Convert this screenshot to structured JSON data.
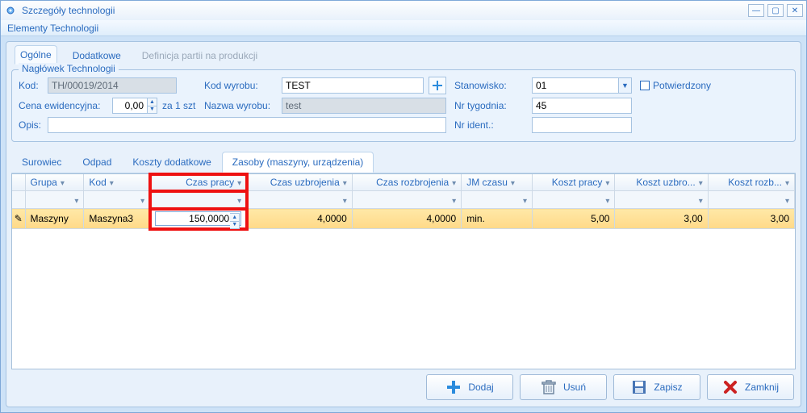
{
  "window": {
    "title": "Szczegóły technologii",
    "menubar": "Elementy Technologii"
  },
  "tabsTop": {
    "t0": "Ogólne",
    "t1": "Dodatkowe",
    "t2": "Definicja partii na produkcji"
  },
  "group": {
    "legend": "Nagłówek Technologii",
    "kod_l": "Kod:",
    "kod_v": "TH/00019/2014",
    "kodwyr_l": "Kod wyrobu:",
    "kodwyr_v": "TEST",
    "stan_l": "Stanowisko:",
    "stan_v": "01",
    "potw": "Potwierdzony",
    "cena_l": "Cena ewidencyjna:",
    "cena_v": "0,00",
    "cena_unit": "za 1 szt",
    "nazwa_l": "Nazwa wyrobu:",
    "nazwa_v": "test",
    "tydz_l": "Nr tygodnia:",
    "tydz_v": "45",
    "opis_l": "Opis:",
    "opis_v": "",
    "ident_l": "Nr ident.:",
    "ident_v": ""
  },
  "subtabs": {
    "s0": "Surowiec",
    "s1": "Odpad",
    "s2": "Koszty dodatkowe",
    "s3": "Zasoby (maszyny, urządzenia)"
  },
  "cols": {
    "c0": "Grupa",
    "c1": "Kod",
    "c2": "Czas pracy",
    "c3": "Czas uzbrojenia",
    "c4": "Czas rozbrojenia",
    "c5": "JM czasu",
    "c6": "Koszt pracy",
    "c7": "Koszt uzbro...",
    "c8": "Koszt rozb..."
  },
  "row0": {
    "grupa": "Maszyny",
    "kod": "Maszyna3",
    "czas_pracy": "150,0000",
    "czas_uzb": "4,0000",
    "czas_rozb": "4,0000",
    "jm": "min.",
    "koszt_pracy": "5,00",
    "koszt_uzb": "3,00",
    "koszt_rozb": "3,00"
  },
  "footer": {
    "dodaj": "Dodaj",
    "usun": "Usuń",
    "zapisz": "Zapisz",
    "zamknij": "Zamknij"
  }
}
